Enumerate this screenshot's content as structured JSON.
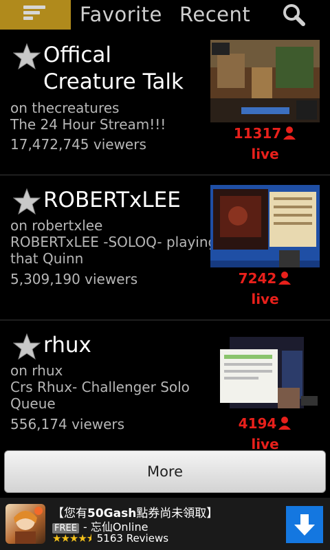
{
  "header": {
    "tabs": [
      {
        "label": "Favorite"
      },
      {
        "label": "Recent"
      }
    ],
    "icons": {
      "menu": "menu-icon",
      "search": "search-icon"
    },
    "accent_color": "#b08a1c"
  },
  "streams": [
    {
      "title": "Offical Creature Talk",
      "title_line1": "Offical",
      "title_line2": "Creature Talk",
      "channel": "on thecreatures",
      "description": "The 24 Hour Stream!!!",
      "viewers": "17,472,745 viewers",
      "live_count": "11317",
      "live_label": "live"
    },
    {
      "title": "ROBERTxLEE",
      "channel": "on robertxlee",
      "description_line1": "ROBERTxLEE -SOLOQ- playing",
      "description_line2": "that Quinn",
      "viewers": "5,309,190 viewers",
      "live_count": "7242",
      "live_label": "live"
    },
    {
      "title": "rhux",
      "channel": "on rhux",
      "description_line1": "Crs Rhux- Challenger Solo",
      "description_line2": "Queue",
      "viewers": "556,174 viewers",
      "live_count": "4194",
      "live_label": "live"
    }
  ],
  "more_button": {
    "label": "More"
  },
  "ad": {
    "title_prefix": "【您有",
    "title_bold": "50Gash",
    "title_suffix": "點券尚未領取】",
    "free_badge": "FREE",
    "app_name": "- 忘仙Online",
    "rating_stars": 4.5,
    "reviews": "5163 Reviews",
    "download_color": "#1477e0"
  },
  "colors": {
    "live_red": "#e8201b",
    "star_gray": "#c8c8c8"
  }
}
